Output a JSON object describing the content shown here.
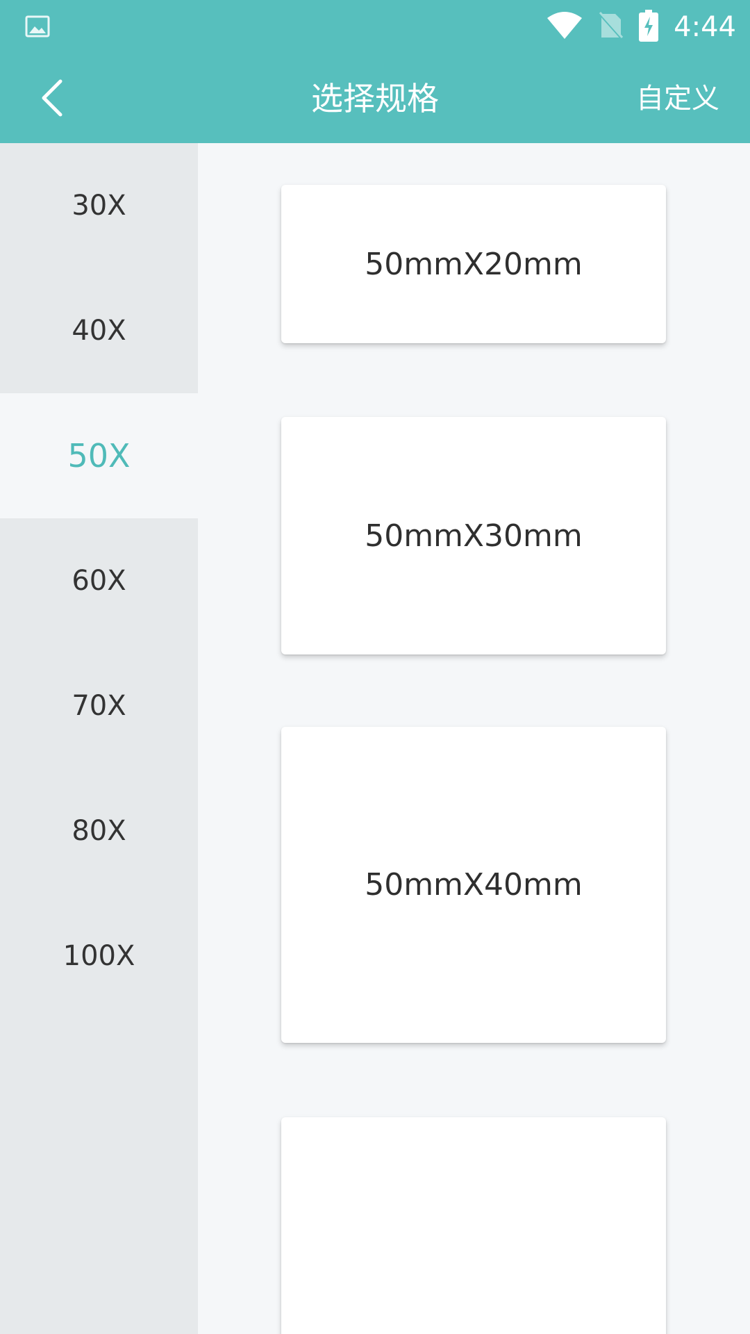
{
  "status_bar": {
    "time": "4:44",
    "icons": [
      "image-icon",
      "wifi-icon",
      "no-sim-icon",
      "battery-charging-icon"
    ]
  },
  "app_bar": {
    "title": "选择规格",
    "back_icon": "back-arrow-icon",
    "custom_label": "自定义"
  },
  "sidebar": {
    "items": [
      {
        "label": "30X",
        "active": false
      },
      {
        "label": "40X",
        "active": false
      },
      {
        "label": "50X",
        "active": true
      },
      {
        "label": "60X",
        "active": false
      },
      {
        "label": "70X",
        "active": false
      },
      {
        "label": "80X",
        "active": false
      },
      {
        "label": "100X",
        "active": false
      }
    ]
  },
  "specs": {
    "items": [
      {
        "label": "50mmX20mm"
      },
      {
        "label": "50mmX30mm"
      },
      {
        "label": "50mmX40mm"
      },
      {
        "label": ""
      }
    ]
  },
  "colors": {
    "accent": "#57bfbd",
    "active_text": "#4fbab8",
    "sidebar_bg": "#e6e9eb",
    "content_bg": "#f5f7f9"
  }
}
